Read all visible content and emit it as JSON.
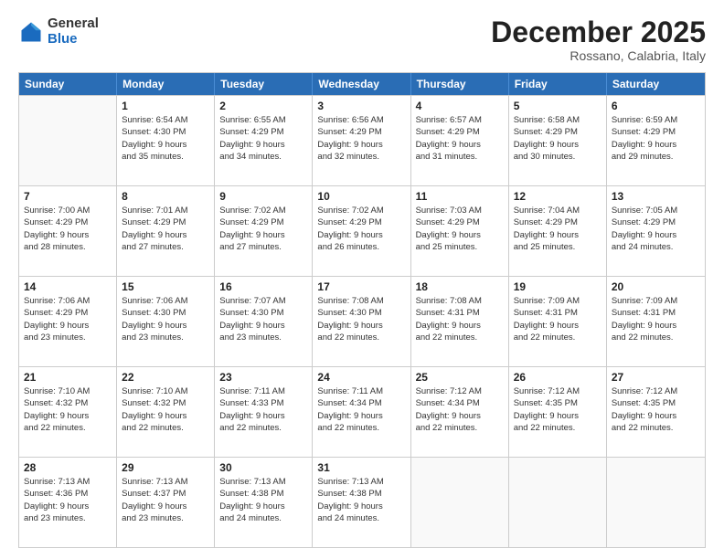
{
  "logo": {
    "general": "General",
    "blue": "Blue"
  },
  "title": "December 2025",
  "subtitle": "Rossano, Calabria, Italy",
  "header_days": [
    "Sunday",
    "Monday",
    "Tuesday",
    "Wednesday",
    "Thursday",
    "Friday",
    "Saturday"
  ],
  "weeks": [
    [
      {
        "day": "",
        "info": ""
      },
      {
        "day": "1",
        "info": "Sunrise: 6:54 AM\nSunset: 4:30 PM\nDaylight: 9 hours\nand 35 minutes."
      },
      {
        "day": "2",
        "info": "Sunrise: 6:55 AM\nSunset: 4:29 PM\nDaylight: 9 hours\nand 34 minutes."
      },
      {
        "day": "3",
        "info": "Sunrise: 6:56 AM\nSunset: 4:29 PM\nDaylight: 9 hours\nand 32 minutes."
      },
      {
        "day": "4",
        "info": "Sunrise: 6:57 AM\nSunset: 4:29 PM\nDaylight: 9 hours\nand 31 minutes."
      },
      {
        "day": "5",
        "info": "Sunrise: 6:58 AM\nSunset: 4:29 PM\nDaylight: 9 hours\nand 30 minutes."
      },
      {
        "day": "6",
        "info": "Sunrise: 6:59 AM\nSunset: 4:29 PM\nDaylight: 9 hours\nand 29 minutes."
      }
    ],
    [
      {
        "day": "7",
        "info": "Sunrise: 7:00 AM\nSunset: 4:29 PM\nDaylight: 9 hours\nand 28 minutes."
      },
      {
        "day": "8",
        "info": "Sunrise: 7:01 AM\nSunset: 4:29 PM\nDaylight: 9 hours\nand 27 minutes."
      },
      {
        "day": "9",
        "info": "Sunrise: 7:02 AM\nSunset: 4:29 PM\nDaylight: 9 hours\nand 27 minutes."
      },
      {
        "day": "10",
        "info": "Sunrise: 7:02 AM\nSunset: 4:29 PM\nDaylight: 9 hours\nand 26 minutes."
      },
      {
        "day": "11",
        "info": "Sunrise: 7:03 AM\nSunset: 4:29 PM\nDaylight: 9 hours\nand 25 minutes."
      },
      {
        "day": "12",
        "info": "Sunrise: 7:04 AM\nSunset: 4:29 PM\nDaylight: 9 hours\nand 25 minutes."
      },
      {
        "day": "13",
        "info": "Sunrise: 7:05 AM\nSunset: 4:29 PM\nDaylight: 9 hours\nand 24 minutes."
      }
    ],
    [
      {
        "day": "14",
        "info": "Sunrise: 7:06 AM\nSunset: 4:29 PM\nDaylight: 9 hours\nand 23 minutes."
      },
      {
        "day": "15",
        "info": "Sunrise: 7:06 AM\nSunset: 4:30 PM\nDaylight: 9 hours\nand 23 minutes."
      },
      {
        "day": "16",
        "info": "Sunrise: 7:07 AM\nSunset: 4:30 PM\nDaylight: 9 hours\nand 23 minutes."
      },
      {
        "day": "17",
        "info": "Sunrise: 7:08 AM\nSunset: 4:30 PM\nDaylight: 9 hours\nand 22 minutes."
      },
      {
        "day": "18",
        "info": "Sunrise: 7:08 AM\nSunset: 4:31 PM\nDaylight: 9 hours\nand 22 minutes."
      },
      {
        "day": "19",
        "info": "Sunrise: 7:09 AM\nSunset: 4:31 PM\nDaylight: 9 hours\nand 22 minutes."
      },
      {
        "day": "20",
        "info": "Sunrise: 7:09 AM\nSunset: 4:31 PM\nDaylight: 9 hours\nand 22 minutes."
      }
    ],
    [
      {
        "day": "21",
        "info": "Sunrise: 7:10 AM\nSunset: 4:32 PM\nDaylight: 9 hours\nand 22 minutes."
      },
      {
        "day": "22",
        "info": "Sunrise: 7:10 AM\nSunset: 4:32 PM\nDaylight: 9 hours\nand 22 minutes."
      },
      {
        "day": "23",
        "info": "Sunrise: 7:11 AM\nSunset: 4:33 PM\nDaylight: 9 hours\nand 22 minutes."
      },
      {
        "day": "24",
        "info": "Sunrise: 7:11 AM\nSunset: 4:34 PM\nDaylight: 9 hours\nand 22 minutes."
      },
      {
        "day": "25",
        "info": "Sunrise: 7:12 AM\nSunset: 4:34 PM\nDaylight: 9 hours\nand 22 minutes."
      },
      {
        "day": "26",
        "info": "Sunrise: 7:12 AM\nSunset: 4:35 PM\nDaylight: 9 hours\nand 22 minutes."
      },
      {
        "day": "27",
        "info": "Sunrise: 7:12 AM\nSunset: 4:35 PM\nDaylight: 9 hours\nand 22 minutes."
      }
    ],
    [
      {
        "day": "28",
        "info": "Sunrise: 7:13 AM\nSunset: 4:36 PM\nDaylight: 9 hours\nand 23 minutes."
      },
      {
        "day": "29",
        "info": "Sunrise: 7:13 AM\nSunset: 4:37 PM\nDaylight: 9 hours\nand 23 minutes."
      },
      {
        "day": "30",
        "info": "Sunrise: 7:13 AM\nSunset: 4:38 PM\nDaylight: 9 hours\nand 24 minutes."
      },
      {
        "day": "31",
        "info": "Sunrise: 7:13 AM\nSunset: 4:38 PM\nDaylight: 9 hours\nand 24 minutes."
      },
      {
        "day": "",
        "info": ""
      },
      {
        "day": "",
        "info": ""
      },
      {
        "day": "",
        "info": ""
      }
    ]
  ]
}
